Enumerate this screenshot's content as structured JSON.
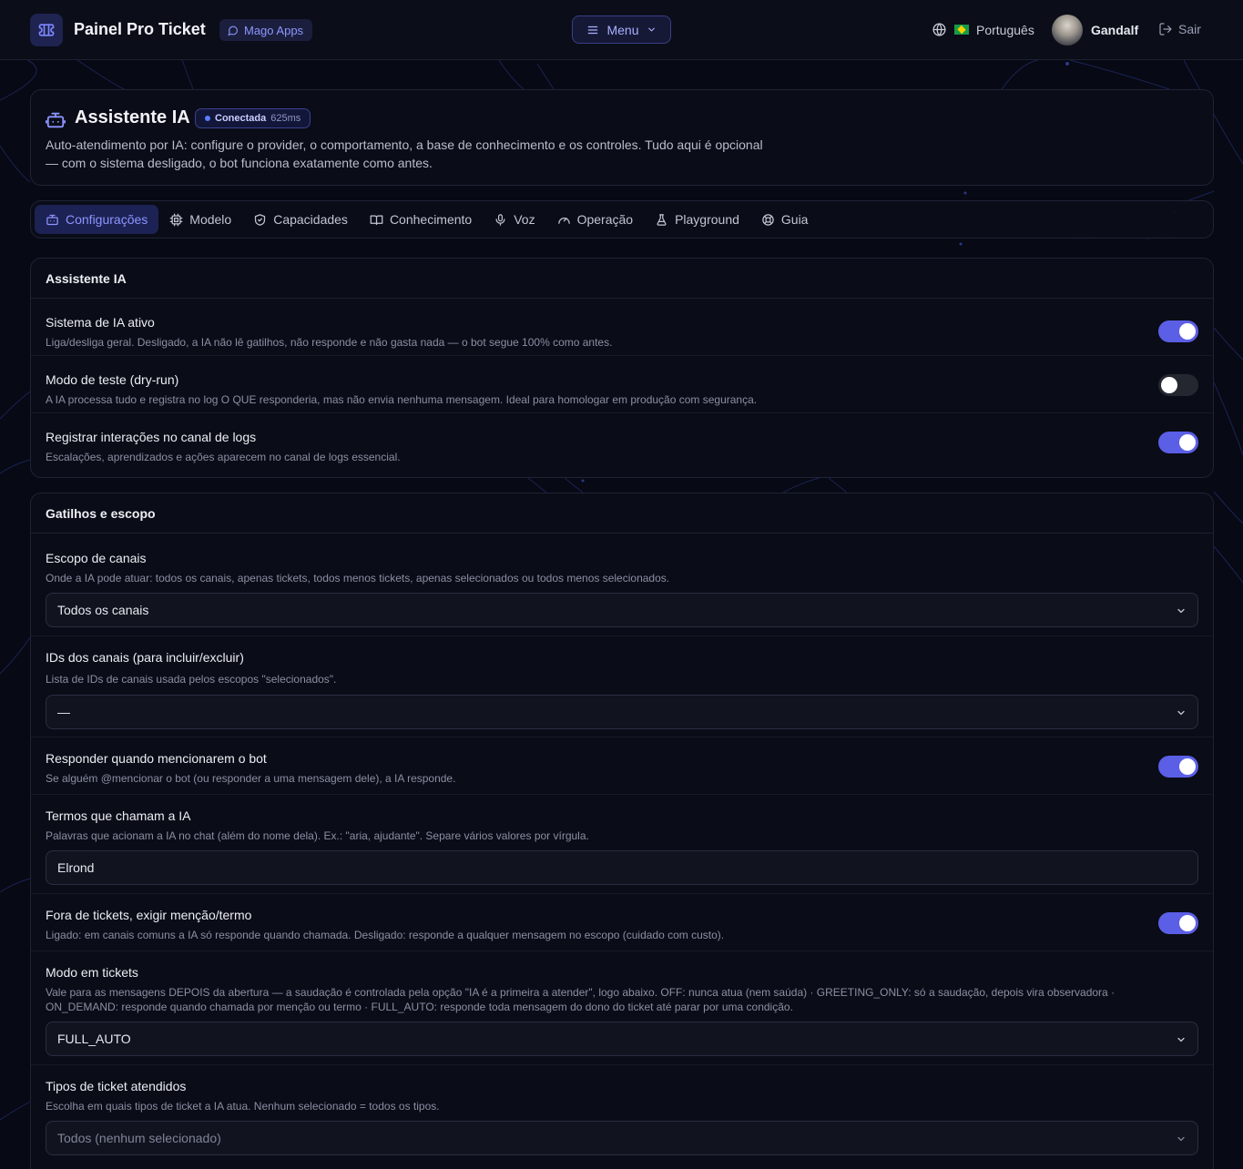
{
  "topbar": {
    "title": "Painel Pro Ticket",
    "badge": "Mago Apps",
    "menu_label": "Menu",
    "language": "Português",
    "user_name": "Gandalf",
    "logout_label": "Sair"
  },
  "header": {
    "title": "Assistente IA",
    "status": "Conectada",
    "latency": "625ms",
    "description": "Auto-atendimento por IA: configure o provider, o comportamento, a base de conhecimento e os controles. Tudo aqui é opcional — com o sistema desligado, o bot funciona exatamente como antes."
  },
  "tabs": [
    {
      "label": "Configurações",
      "icon": "robot-icon",
      "active": true
    },
    {
      "label": "Modelo",
      "icon": "cpu-icon"
    },
    {
      "label": "Capacidades",
      "icon": "shield-icon"
    },
    {
      "label": "Conhecimento",
      "icon": "book-icon"
    },
    {
      "label": "Voz",
      "icon": "microphone-icon"
    },
    {
      "label": "Operação",
      "icon": "gauge-icon"
    },
    {
      "label": "Playground",
      "icon": "flask-icon"
    },
    {
      "label": "Guia",
      "icon": "lifebuoy-icon"
    }
  ],
  "assistant_section": {
    "title": "Assistente IA",
    "rows": [
      {
        "title": "Sistema de IA ativo",
        "desc": "Liga/desliga geral. Desligado, a IA não lê gatilhos, não responde e não gasta nada — o bot segue 100% como antes.",
        "enabled": true
      },
      {
        "title": "Modo de teste (dry-run)",
        "desc": "A IA processa tudo e registra no log O QUE responderia, mas não envia nenhuma mensagem. Ideal para homologar em produção com segurança.",
        "enabled": false
      },
      {
        "title": "Registrar interações no canal de logs",
        "desc": "Escalações, aprendizados e ações aparecem no canal de logs essencial.",
        "enabled": true
      }
    ]
  },
  "triggers_section": {
    "title": "Gatilhos e escopo",
    "channel_scope": {
      "title": "Escopo de canais",
      "desc": "Onde a IA pode atuar: todos os canais, apenas tickets, todos menos tickets, apenas selecionados ou todos menos selecionados.",
      "value": "Todos os canais"
    },
    "channel_ids": {
      "title": "IDs dos canais (para incluir/excluir)",
      "desc": "Lista de IDs de canais usada pelos escopos \"selecionados\".",
      "value": "—"
    },
    "mention": {
      "title": "Responder quando mencionarem o bot",
      "desc": "Se alguém @mencionar o bot (ou responder a uma mensagem dele), a IA responde.",
      "enabled": true
    },
    "terms": {
      "title": "Termos que chamam a IA",
      "desc": "Palavras que acionam a IA no chat (além do nome dela). Ex.: \"aria, ajudante\". Separe vários valores por vírgula.",
      "value": "Elrond"
    },
    "outside_tickets": {
      "title": "Fora de tickets, exigir menção/termo",
      "desc": "Ligado: em canais comuns a IA só responde quando chamada. Desligado: responde a qualquer mensagem no escopo (cuidado com custo).",
      "enabled": true
    },
    "ticket_mode": {
      "title": "Modo em tickets",
      "desc": "Vale para as mensagens DEPOIS da abertura — a saudação é controlada pela opção \"IA é a primeira a atender\", logo abaixo. OFF: nunca atua (nem saúda) · GREETING_ONLY: só a saudação, depois vira observadora · ON_DEMAND: responde quando chamada por menção ou termo · FULL_AUTO: responde toda mensagem do dono do ticket até parar por uma condição.",
      "value": "FULL_AUTO"
    },
    "ticket_types": {
      "title": "Tipos de ticket atendidos",
      "desc": "Escolha em quais tipos de ticket a IA atua. Nenhum selecionado = todos os tipos.",
      "value": "Todos (nenhum selecionado)"
    }
  },
  "colors": {
    "accent": "#5b5fe6",
    "background": "#070914",
    "card": "#0b0d18",
    "status_dot": "#5b7cff"
  }
}
